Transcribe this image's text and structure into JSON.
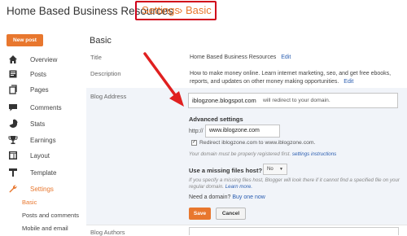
{
  "header": {
    "blog_title": "Home Based Business Resources",
    "breadcrumb_settings": "Settings",
    "breadcrumb_sep": "›",
    "breadcrumb_basic": "Basic"
  },
  "sidebar": {
    "new_post": "New post",
    "items": [
      {
        "label": "Overview",
        "icon": "home-icon"
      },
      {
        "label": "Posts",
        "icon": "posts-icon"
      },
      {
        "label": "Pages",
        "icon": "pages-icon"
      },
      {
        "label": "Comments",
        "icon": "comments-icon"
      },
      {
        "label": "Stats",
        "icon": "stats-icon"
      },
      {
        "label": "Earnings",
        "icon": "trophy-icon"
      },
      {
        "label": "Layout",
        "icon": "layout-icon"
      },
      {
        "label": "Template",
        "icon": "template-icon"
      },
      {
        "label": "Settings",
        "icon": "wrench-icon"
      }
    ],
    "sub_items": [
      "Basic",
      "Posts and comments",
      "Mobile and email"
    ]
  },
  "main": {
    "section_title": "Basic",
    "title_label": "Title",
    "title_value": "Home Based Business Resources",
    "edit_label": "Edit",
    "description_label": "Description",
    "description_value": "How to make money online. Learn internet marketing, seo, and get free ebooks, reports, and updates on other money making opportunities.",
    "blog_address_label": "Blog Address",
    "blog_address_value": "iblogzone.blogspot.com",
    "redirect_note": "will redirect to your domain.",
    "advanced_title": "Advanced settings",
    "http_label": "http://",
    "www_value": "www.iblogzone.com",
    "redirect_checkbox": "Redirect iblogzone.com to www.iblogzone.com.",
    "domain_note": "Your domain must be properly registered first.",
    "settings_instructions": "settings instructions",
    "missing_files_label": "Use a missing files host?",
    "missing_files_value": "No",
    "missing_help": "If you specify a missing files host, Blogger will look there if it cannot find a specified file on your regular domain.",
    "learn_more": "Learn more.",
    "need_domain": "Need a domain?",
    "buy_one_now": "Buy one now",
    "save": "Save",
    "cancel": "Cancel",
    "blog_authors_label": "Blog Authors"
  },
  "colors": {
    "accent": "#e8772e",
    "highlight_box": "#d0021b",
    "link": "#2a5db0",
    "arrow": "#e02020"
  }
}
